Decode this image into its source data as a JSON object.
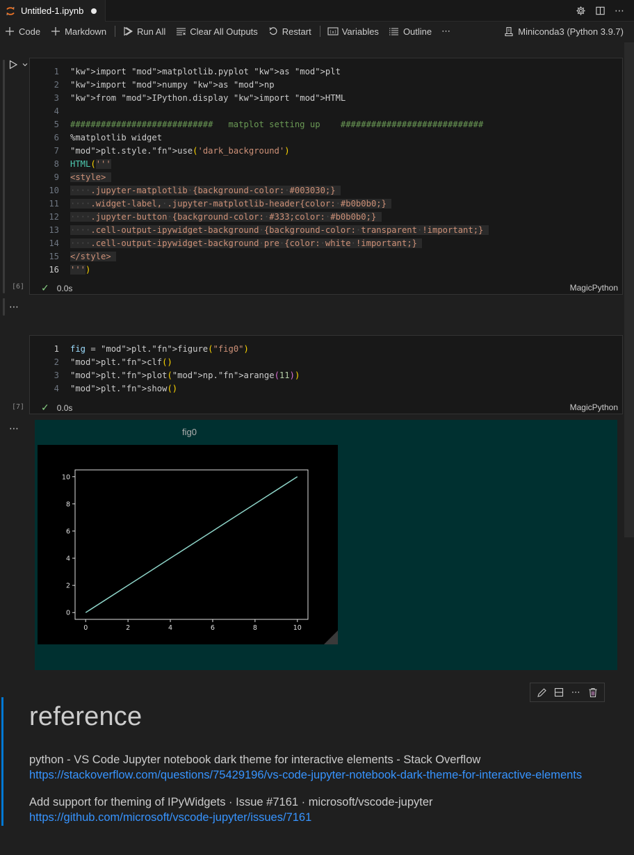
{
  "tab": {
    "title": "Untitled-1.ipynb",
    "dirty": true
  },
  "tab_actions": {
    "settings": "gear-icon",
    "split": "split-editor-icon",
    "more": "ellipsis-icon"
  },
  "toolbar": {
    "code": "Code",
    "markdown": "Markdown",
    "run_all": "Run All",
    "clear_all_outputs": "Clear All Outputs",
    "restart": "Restart",
    "variables": "Variables",
    "outline": "Outline",
    "more": "⋯",
    "kernel": "Miniconda3 (Python 3.9.7)"
  },
  "cells": [
    {
      "exec_count": "[6]",
      "status_time": "0.0s",
      "language": "MagicPython",
      "lines": [
        "import matplotlib.pyplot as plt",
        "import numpy as np",
        "from IPython.display import HTML",
        "",
        "############################   matplot setting up    ############################",
        "%matplotlib widget",
        "plt.style.use('dark_background')",
        "HTML('''",
        "<style>",
        "    .jupyter-matplotlib {background-color: #003030;}",
        "    .widget-label, .jupyter-matplotlib-header{color: #b0b0b0;}",
        "    .jupyter-button {background-color: #333;color: #b0b0b0;}",
        "    .cell-output-ipywidget-background {background-color: transparent !important;}",
        "    .cell-output-ipywidget-background pre {color: white !important;}",
        "</style>",
        "''')"
      ]
    },
    {
      "exec_count": "[7]",
      "status_time": "0.0s",
      "language": "MagicPython",
      "lines": [
        "fig = plt.figure(\"fig0\")",
        "plt.clf()",
        "plt.plot(np.arange(11))",
        "plt.show()"
      ]
    }
  ],
  "output_more": "⋯",
  "widget": {
    "figure_title": "fig0",
    "background": "#003030",
    "header_color": "#b0b0b0"
  },
  "chart_data": {
    "type": "line",
    "title": "",
    "xlabel": "",
    "ylabel": "",
    "x": [
      0,
      1,
      2,
      3,
      4,
      5,
      6,
      7,
      8,
      9,
      10
    ],
    "series": [
      {
        "name": "np.arange(11)",
        "values": [
          0,
          1,
          2,
          3,
          4,
          5,
          6,
          7,
          8,
          9,
          10
        ],
        "color": "#8dd3c7"
      }
    ],
    "xlim": [
      -0.5,
      10.5
    ],
    "ylim": [
      -0.5,
      10.5
    ],
    "xticks": [
      "0",
      "2",
      "4",
      "6",
      "8",
      "10"
    ],
    "yticks": [
      "0",
      "2",
      "4",
      "6",
      "8",
      "10"
    ],
    "grid": false,
    "legend": "none"
  },
  "markdown": {
    "heading": "reference",
    "refs": [
      {
        "title": "python - VS Code Jupyter notebook dark theme for interactive elements - Stack Overflow",
        "url": "https://stackoverflow.com/questions/75429196/vs-code-jupyter-notebook-dark-theme-for-interactive-elements"
      },
      {
        "title": "Add support for theming of IPyWidgets · Issue #7161 · microsoft/vscode-jupyter",
        "url": "https://github.com/microsoft/vscode-jupyter/issues/7161"
      }
    ],
    "toolbar": [
      "edit-icon",
      "split-cell-icon",
      "ellipsis-icon",
      "delete-icon"
    ]
  },
  "colors": {
    "accent": "#0078d4",
    "link": "#3794ff",
    "success": "#89d185"
  }
}
